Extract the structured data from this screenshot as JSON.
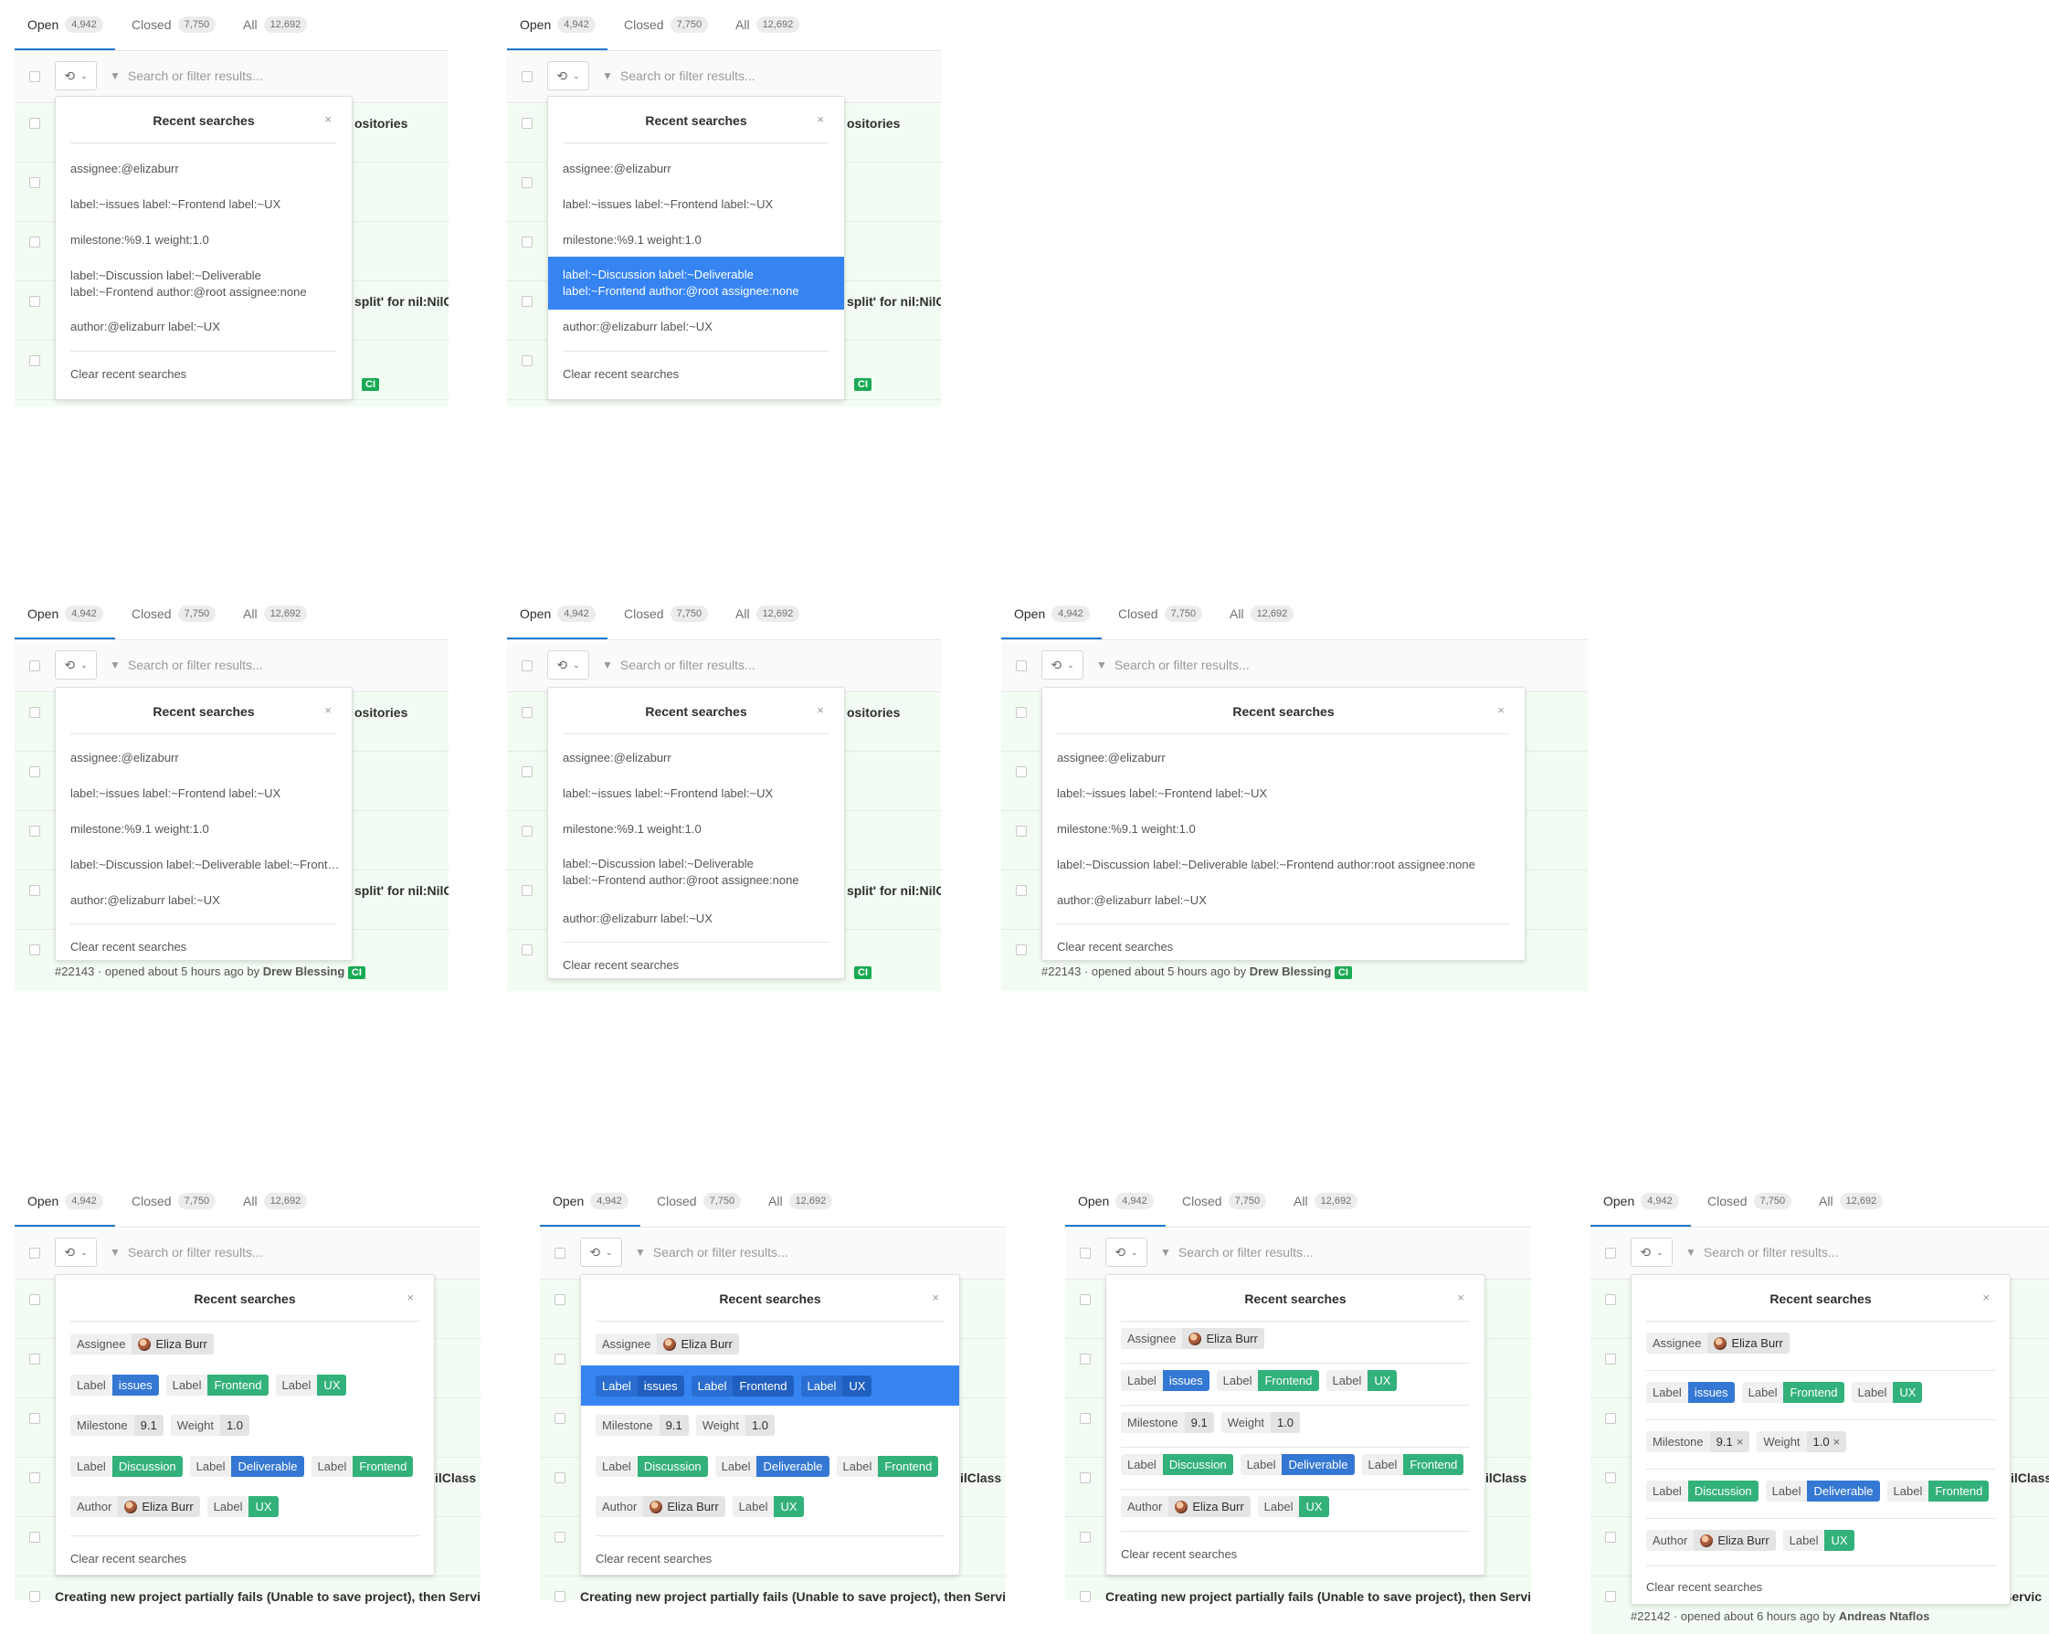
{
  "tabs": {
    "open": "Open",
    "open_count": "4,942",
    "closed": "Closed",
    "closed_count": "7,750",
    "all": "All",
    "all_count": "12,692"
  },
  "search_placeholder": "Search or filter results...",
  "recent_title": "Recent searches",
  "clear_label": "Clear recent searches",
  "close_glyph": "×",
  "bg_peek": {
    "repositories": "ositories",
    "split": "split' for nil:NilC",
    "ilclass": "ilClass",
    "ci": "CI",
    "meta": "#22143 · opened about 5 hours ago by",
    "meta_author": "Drew Blessing",
    "creating": "Creating new project partially fails (Unable to save project), then Service",
    "servic": "Servic",
    "meta2": "#22142 · opened about 6 hours ago by",
    "meta2_author": "Andreas Ntaflos"
  },
  "text_items": {
    "i1": "assignee:@elizaburr",
    "i2": "label:~issues label:~Frontend label:~UX",
    "i3": "milestone:%9.1 weight:1.0",
    "i4a": "label:~Discussion label:~Deliverable",
    "i4b": "label:~Frontend author:@root assignee:none",
    "i4_trunc": "label:~Discussion label:~Deliverable label:~Frontend author:@root assignee:none",
    "i4_full": "label:~Discussion label:~Deliverable label:~Frontend author:root assignee:none",
    "i5": "author:@elizaburr label:~UX"
  },
  "tokens": {
    "assignee": "Assignee",
    "label": "Label",
    "milestone": "Milestone",
    "weight": "Weight",
    "author": "Author",
    "eliza": "Eliza Burr",
    "issues": "issues",
    "frontend": "Frontend",
    "ux": "UX",
    "m91": "9.1",
    "w10": "1.0",
    "discussion": "Discussion",
    "deliverable": "Deliverable",
    "x": "×"
  },
  "icons": {
    "history": "history-icon",
    "funnel": "filter-icon",
    "chevron": "chevron-down-icon",
    "close": "close-icon",
    "avatar": "avatar"
  },
  "colors": {
    "highlight": "#3684f2",
    "label_green": "#33b17a",
    "label_blue": "#3578d3",
    "row_bg": "#f2fcf2",
    "tab_active": "#1f78d1"
  }
}
